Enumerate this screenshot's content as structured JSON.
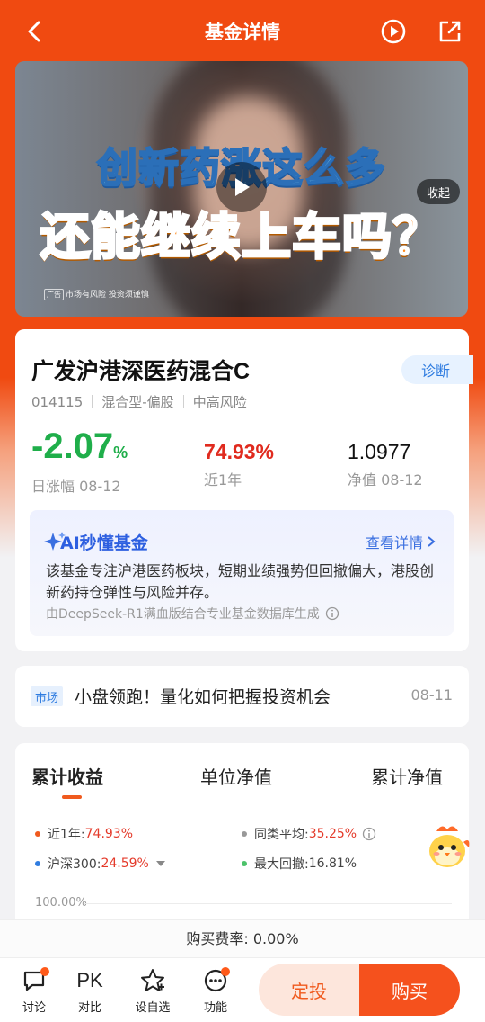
{
  "header": {
    "title": "基金详情"
  },
  "video": {
    "headline_line1": "创新药涨这么多",
    "headline_line2": "还能继续上车吗？",
    "collapse_label": "收起",
    "ad_tag": "广告",
    "risk_note": "市场有风险 投资须谨慎"
  },
  "fund": {
    "name": "广发沪港深医药混合C",
    "code": "014115",
    "type": "混合型-偏股",
    "risk": "中高风险",
    "diagnose_label": "诊断",
    "daily_change_value": "-2.07",
    "daily_change_unit": "%",
    "daily_change_label": "日涨幅 08-12",
    "year_return": "74.93%",
    "year_return_label": "近1年",
    "nav": "1.0977",
    "nav_label": "净值 08-12"
  },
  "ai": {
    "title": "AI秒懂基金",
    "more_label": "查看详情",
    "text": "该基金专注沪港医药板块，短期业绩强势但回撤偏大，港股创新药持仓弹性与风险并存。",
    "source": "由DeepSeek-R1满血版结合专业基金数据库生成"
  },
  "news": {
    "tag": "市场",
    "title": "小盘领跑！量化如何把握投资机会",
    "date": "08-11"
  },
  "chart": {
    "tabs": [
      "累计收益",
      "单位净值",
      "累计净值"
    ],
    "legend": {
      "year_label": "近1年:",
      "year_value": "74.93%",
      "peer_label": "同类平均:",
      "peer_value": "35.25%",
      "hs300_label": "沪深300:",
      "hs300_value": "24.59%",
      "drawdown_label": "最大回撤:",
      "drawdown_value": "16.81%"
    },
    "y_top_label": "100.00%",
    "colors": {
      "fund": "#f05a1e",
      "peer": "#999999",
      "hs300": "#2f7ce0",
      "drawdown": "#4cc26a"
    }
  },
  "fee": {
    "text": "购买费率: 0.00%"
  },
  "bottom_bar": {
    "discuss": "讨论",
    "pk_icon_text": "PK",
    "compare": "对比",
    "favorite": "设自选",
    "functions": "功能",
    "dingtou": "定投",
    "buy": "购买"
  },
  "icons": [
    "back-arrow-icon",
    "play-circle-icon",
    "share-icon",
    "video-play-icon",
    "sparkle-icon",
    "chevron-right-icon",
    "info-icon",
    "dropdown-icon",
    "mascot-icon",
    "chat-icon",
    "star-icon",
    "more-icon"
  ],
  "accent_color": "#f04a11"
}
